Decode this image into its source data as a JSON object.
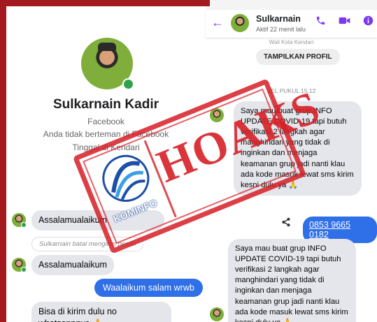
{
  "left_panel": {
    "profile": {
      "name": "Sulkarnain Kadir",
      "platform": "Facebook",
      "relation": "Anda tidak berteman di Facebook",
      "location": "Tinggal di Kendari"
    },
    "messages": [
      {
        "text": "Assalamualaikum",
        "direction": "in"
      },
      {
        "text": "Sulkarnain batal mengirim pesan",
        "direction": "system"
      },
      {
        "text": "Assalamualaikum",
        "direction": "in"
      },
      {
        "text": "Waalaikum salam wrwb",
        "direction": "out"
      },
      {
        "text": "Bisa di kirim dulu no whatsappnya 🙏",
        "direction": "in"
      }
    ]
  },
  "right_panel": {
    "header": {
      "contact_name": "Sulkarnain",
      "status": "Aktif 22 menit lalu"
    },
    "faded_line": "Wali Kota Kendari",
    "profile_button": "TAMPILKAN PROFIL",
    "timestamp": "SEL PUKUL 15.12",
    "messages": [
      {
        "text": "Saya mau buat grup INFO UPDATE COVID-19 tapi butuh verifikasi 2 langkah agar manghindari yang tidak di inginkan dan menjaga keamanan grup jadi nanti klau ada kode masuk lewat sms kirim kesni dulu ya 🙏",
        "direction": "in"
      },
      {
        "text": "0853 9665 0182",
        "direction": "out"
      },
      {
        "text": "Saya mau buat grup INFO UPDATE COVID-19 tapi butuh verifikasi 2 langkah agar manghindari yang tidak di inginkan dan menjaga keamanan grup jadi nanti klau ada kode masuk lewat sms kirim kesni dulu ya 🙏",
        "direction": "in"
      }
    ]
  },
  "stamp": {
    "word": "HOAKS",
    "logo_text": "KOMINFO",
    "color": "#d61f26"
  },
  "colors": {
    "accent": "#7c3aed",
    "outgoing_bubble": "#2f6fe8",
    "online": "#31a24c",
    "frame": "#a3191d"
  }
}
